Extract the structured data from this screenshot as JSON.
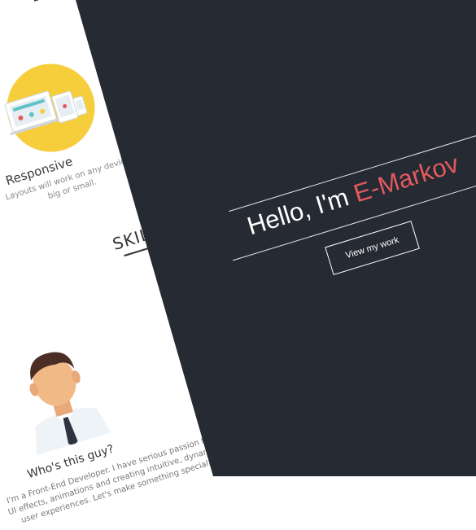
{
  "services": {
    "responsive": {
      "title": "Responsive",
      "description": "Layouts will work on any device, big or small."
    }
  },
  "skills": {
    "title": "SKILLS"
  },
  "about": {
    "title": "Who's this guy?",
    "description": "I'm a Front-End Developer. I have serious passion for UI effects, animations and creating intuitive, dynamic user experiences. Let's make something special."
  },
  "hero": {
    "greeting": "Hello, I'm ",
    "name": "E-Markov",
    "button_label": "View my work"
  },
  "colors": {
    "dark_background": "#262a33",
    "accent": "#e35a5e",
    "icon_circle": "#f6cd3b"
  }
}
